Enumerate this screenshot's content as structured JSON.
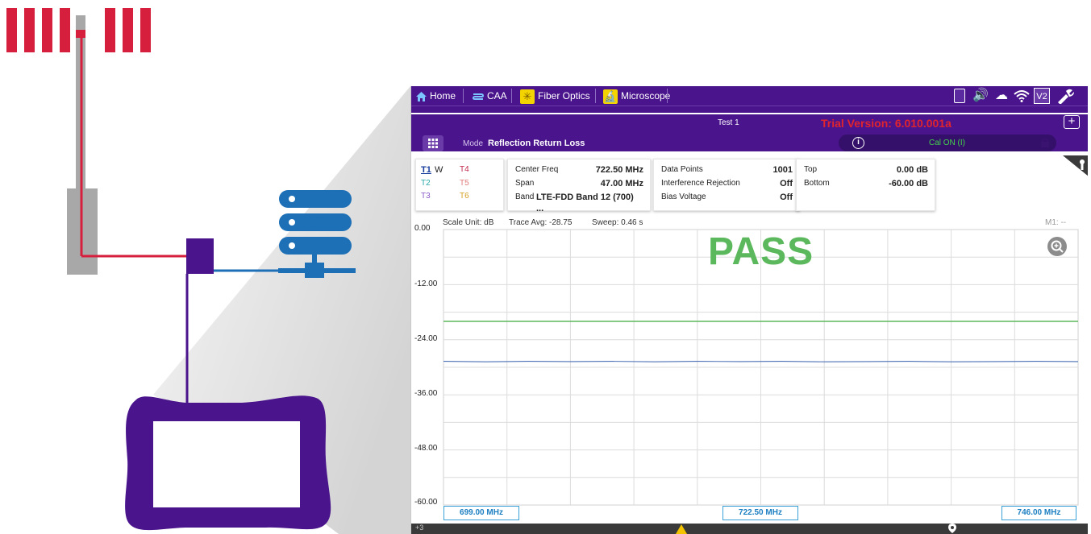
{
  "toolbar": {
    "tabs": [
      {
        "label": "Home",
        "icon": "home-icon"
      },
      {
        "label": "CAA",
        "icon": "caa-icon"
      },
      {
        "label": "Fiber Optics",
        "icon": "fiber-optics-icon"
      },
      {
        "label": "Microscope",
        "icon": "microscope-icon"
      }
    ],
    "status_icons": [
      "battery-icon",
      "speaker-icon",
      "cloud-icon",
      "wifi-icon",
      "vnc-icon",
      "settings-icon"
    ],
    "vnc_label": "V2"
  },
  "header": {
    "test_title": "Test 1",
    "trial_text": "Trial Version: 6.010.001a",
    "plus_label": "+",
    "mode_label": "Mode",
    "mode_value": "Reflection Return Loss",
    "cal_status": "Cal ON (I)"
  },
  "traces": {
    "t1": "T1",
    "t1_mode": "W",
    "t2": "T2",
    "t3": "T3",
    "t4": "T4",
    "t5": "T5",
    "t6": "T6"
  },
  "settings_panel": {
    "center_freq_label": "Center Freq",
    "center_freq_value": "722.50 MHz",
    "span_label": "Span",
    "span_value": "47.00 MHz",
    "band_label": "Band",
    "band_value": "LTE-FDD Band 12 (700) ..."
  },
  "measurement_panel": {
    "data_points_label": "Data Points",
    "data_points_value": "1001",
    "interference_label": "Interference Rejection",
    "interference_value": "Off",
    "bias_label": "Bias Voltage",
    "bias_value": "Off"
  },
  "scale_panel": {
    "top_label": "Top",
    "top_value": "0.00 dB",
    "bottom_label": "Bottom",
    "bottom_value": "-60.00 dB"
  },
  "chart_header": {
    "scale_unit": "Scale Unit: dB",
    "trace_avg": "Trace Avg: -28.75",
    "sweep": "Sweep: 0.46 s",
    "marker": "M1: --"
  },
  "result": {
    "text": "PASS",
    "color": "#5cb85c"
  },
  "chart_data": {
    "type": "line",
    "ylim": [
      -60,
      0
    ],
    "y_ticks": [
      "0.00",
      "-12.00",
      "-24.00",
      "-36.00",
      "-48.00",
      "-60.00"
    ],
    "x_range_mhz": [
      699.0,
      746.0
    ],
    "x_labels": [
      "699.00 MHz",
      "722.50 MHz",
      "746.00 MHz"
    ],
    "series": [
      {
        "color": "#4a6fb5",
        "values": [
          -28.7,
          -28.8,
          -28.7,
          -28.75,
          -28.7,
          -28.8,
          -28.7,
          -28.75,
          -28.7,
          -28.8,
          -28.75,
          -28.7,
          -28.8,
          -28.75,
          -28.7,
          -28.75
        ]
      },
      {
        "color": "#5cb85c",
        "values": [
          -20.0,
          -20.0
        ]
      }
    ]
  },
  "status_bar": {
    "left_badge": "+3"
  },
  "colors": {
    "brand": "#d61f3c",
    "toolbar": "#4a148c",
    "accent_green": "#43d24b",
    "link_blue": "#1c7fc2"
  }
}
